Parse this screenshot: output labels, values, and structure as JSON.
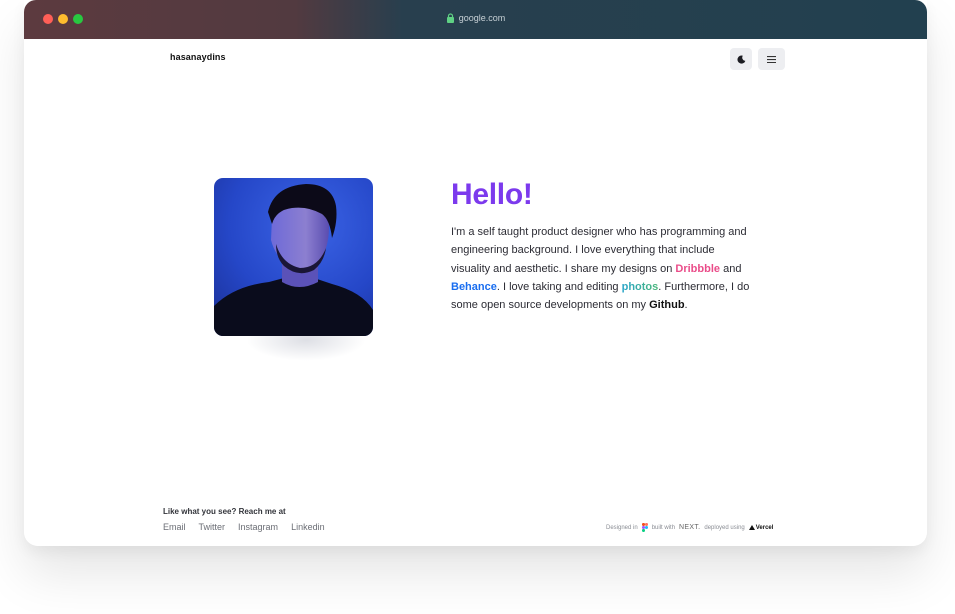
{
  "browser": {
    "url": "google.com"
  },
  "header": {
    "logo": "hasanaydins"
  },
  "hero": {
    "heading": "Hello!",
    "bio": {
      "part1": "I'm a self taught product designer who has programming and engineering background. I love everything that include visuality and aesthetic. I share my designs on ",
      "dribbble": "Dribbble",
      "and": " and ",
      "behance": "Behance",
      "part2": ". I love taking and editing ",
      "photos": "photos",
      "part3": ". Furthermore, I do some open source developments on my ",
      "github": "Github",
      "end": "."
    }
  },
  "footer": {
    "reach": "Like what you see? Reach me at",
    "links": [
      "Email",
      "Twitter",
      "Instagram",
      "Linkedin"
    ],
    "designed_in": "Designed in",
    "built_with": "built with",
    "next": "NEXT.",
    "deployed_using": "deployed using",
    "vercel": "Vercel"
  },
  "colors": {
    "accent": "#7c3aed",
    "dribbble": "#ea4c89",
    "behance": "#1a6ef0"
  },
  "icons": {
    "theme": "moon-icon",
    "menu": "hamburger-menu-icon",
    "address": "lock-icon"
  }
}
